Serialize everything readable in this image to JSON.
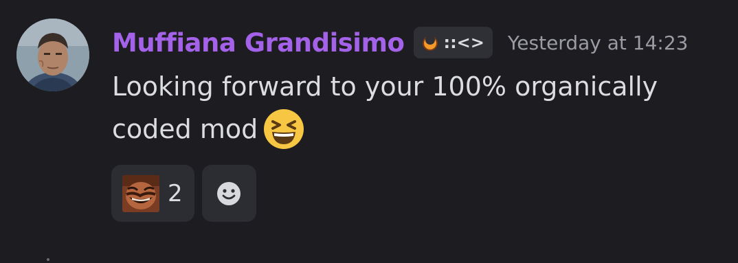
{
  "message": {
    "author": {
      "name": "Muffiana Grandisimo",
      "name_color": "#a462e8",
      "avatar_icon": "avatar-portrait-man"
    },
    "server_tag": {
      "icon": "orange-crescent-icon",
      "text": "::<>"
    },
    "timestamp": "Yesterday at 14:23",
    "content": {
      "line1": "Looking forward to your 100% organically",
      "line2": "coded mod",
      "emoji": "laughing-face-emoji"
    },
    "reactions": [
      {
        "emoji": "laughing-man-custom-emoji",
        "count": "2"
      }
    ],
    "add_reaction_icon": "smiley-face-icon"
  }
}
